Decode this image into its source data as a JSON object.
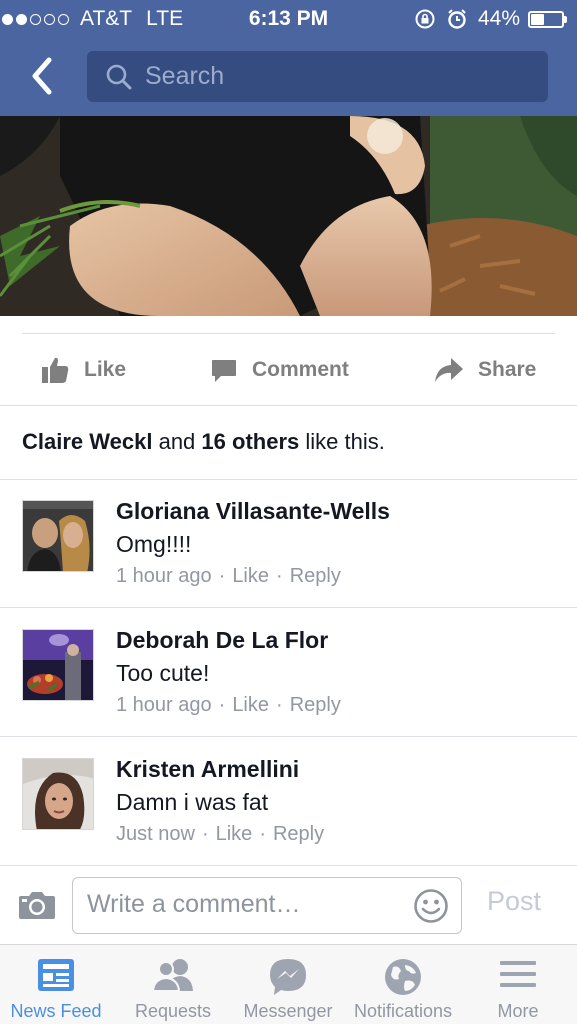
{
  "status_bar": {
    "carrier": "AT&T",
    "network": "LTE",
    "time": "6:13 PM",
    "battery": "44%",
    "battery_level": 0.44,
    "signal_bars": 2,
    "signal_total": 5
  },
  "nav": {
    "back_icon": "chevron-left-icon",
    "search_placeholder": "Search"
  },
  "post_actions": {
    "like": "Like",
    "comment": "Comment",
    "share": "Share"
  },
  "likes_summary": {
    "name": "Claire Weckl",
    "joiner": "and",
    "others": "16 others",
    "suffix": "like this."
  },
  "comments": [
    {
      "author": "Gloriana Villasante-Wells",
      "text": "Omg!!!!",
      "time": "1 hour ago",
      "like": "Like",
      "reply": "Reply"
    },
    {
      "author": "Deborah De La Flor",
      "text": "Too cute!",
      "time": "1 hour ago",
      "like": "Like",
      "reply": "Reply"
    },
    {
      "author": "Kristen Armellini",
      "text": "Damn i was fat",
      "time": "Just now",
      "like": "Like",
      "reply": "Reply"
    }
  ],
  "composer": {
    "placeholder": "Write a comment…",
    "post_label": "Post"
  },
  "tabs": [
    {
      "label": "News Feed",
      "icon": "news-feed-icon",
      "active": true
    },
    {
      "label": "Requests",
      "icon": "requests-icon",
      "active": false
    },
    {
      "label": "Messenger",
      "icon": "messenger-icon",
      "active": false
    },
    {
      "label": "Notifications",
      "icon": "globe-icon",
      "active": false
    },
    {
      "label": "More",
      "icon": "menu-icon",
      "active": false
    }
  ],
  "colors": {
    "header_blue": "#4b65a1",
    "search_bg": "#354c80",
    "active_tab": "#4a90e2",
    "muted_text": "#9197a3"
  }
}
